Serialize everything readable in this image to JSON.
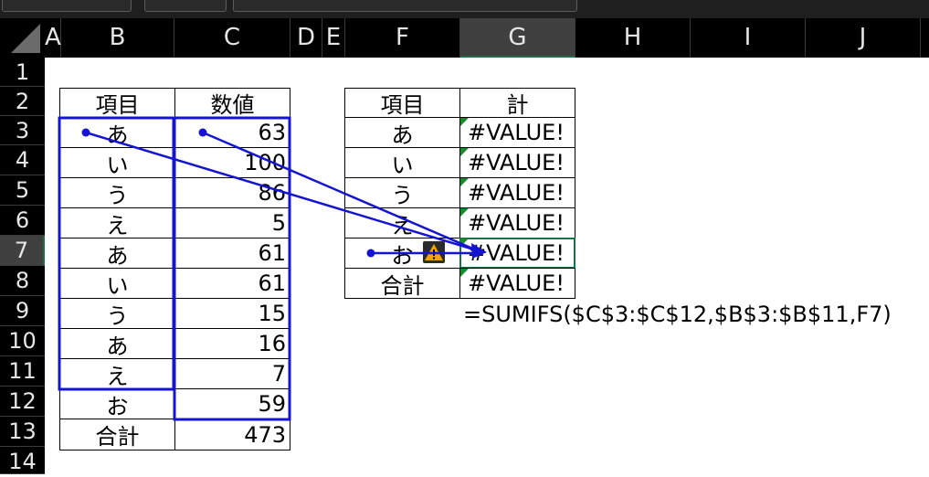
{
  "top_bar": {
    "name_box": "",
    "formula_bar": ""
  },
  "columns": [
    "A",
    "B",
    "C",
    "D",
    "E",
    "F",
    "G",
    "H",
    "I",
    "J"
  ],
  "selected_column": "G",
  "rows": [
    "1",
    "2",
    "3",
    "4",
    "5",
    "6",
    "7",
    "8",
    "9",
    "10",
    "11",
    "12",
    "13",
    "14"
  ],
  "selected_row": "7",
  "left_table": {
    "headers": [
      "項目",
      "数値"
    ],
    "rows": [
      [
        "あ",
        "63"
      ],
      [
        "い",
        "100"
      ],
      [
        "う",
        "86"
      ],
      [
        "え",
        "5"
      ],
      [
        "あ",
        "61"
      ],
      [
        "い",
        "61"
      ],
      [
        "う",
        "15"
      ],
      [
        "あ",
        "16"
      ],
      [
        "え",
        "7"
      ],
      [
        "お",
        "59"
      ],
      [
        "合計",
        "473"
      ]
    ]
  },
  "right_table": {
    "headers": [
      "項目",
      "計"
    ],
    "rows": [
      [
        "あ",
        "#VALUE!"
      ],
      [
        "い",
        "#VALUE!"
      ],
      [
        "う",
        "#VALUE!"
      ],
      [
        "え",
        "#VALUE!"
      ],
      [
        "お",
        "#VALUE!"
      ],
      [
        "合計",
        "#VALUE!"
      ]
    ]
  },
  "formula_note": "=SUMIFS($C$3:$C$12,$B$3:$B$11,F7)",
  "colors": {
    "trace": "#1414d2",
    "error_marker": "#1b8a2f",
    "selection": "#1e7145"
  },
  "icons": {
    "error_indicator": "warning-icon"
  }
}
